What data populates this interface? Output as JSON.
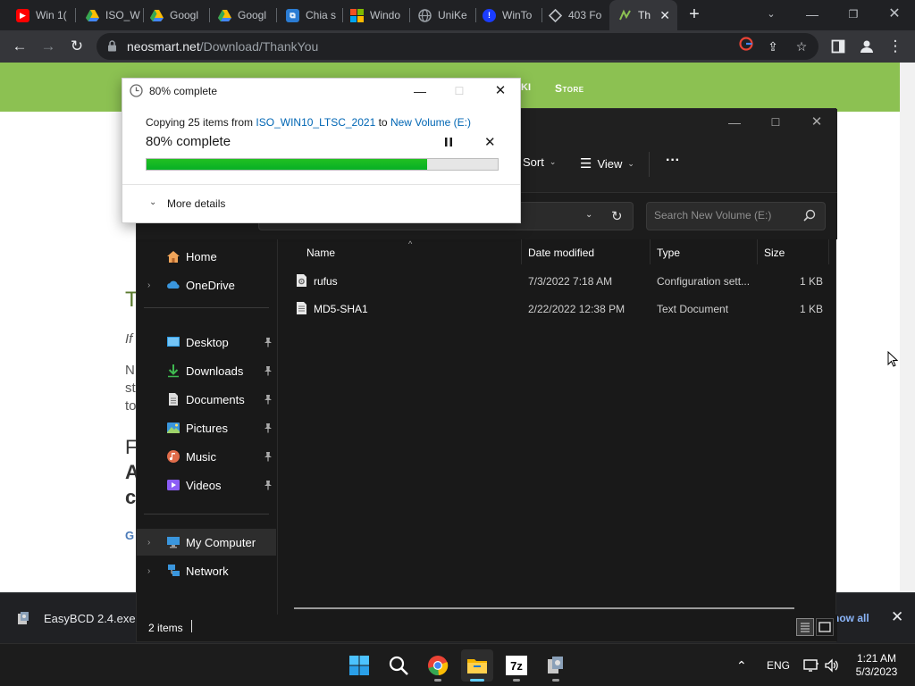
{
  "browser": {
    "tabs": [
      {
        "label": "Win 1(",
        "icon": "youtube-icon",
        "color": "#ff0000"
      },
      {
        "label": "ISO_W",
        "icon": "google-drive-icon",
        "color": "#fbbc04"
      },
      {
        "label": "Googl",
        "icon": "google-drive-icon",
        "color": "#fbbc04"
      },
      {
        "label": "Googl",
        "icon": "google-drive-icon",
        "color": "#fbbc04"
      },
      {
        "label": "Chia s",
        "icon": "shared-folder-icon",
        "color": "#2b7cd3"
      },
      {
        "label": "Windo",
        "icon": "microsoft-icon",
        "color": "#f25022"
      },
      {
        "label": "UniKe",
        "icon": "globe-icon",
        "color": "#9aa0a6"
      },
      {
        "label": "WinTo",
        "icon": "wintohdd-icon",
        "color": "#1a3cff"
      },
      {
        "label": "403 Fo",
        "icon": "diamond-icon",
        "color": "#9aa0a6"
      },
      {
        "label": "Th",
        "icon": "neosmart-icon",
        "color": "#8cc152"
      }
    ],
    "active_tab": 9,
    "url_host": "neosmart.net",
    "url_path": "/Download/ThankYou"
  },
  "website": {
    "nav_store": "Store",
    "nav_fragment": "KI",
    "fragments": [
      "T",
      "If",
      "N",
      "st",
      "to"
    ],
    "big_fragments": [
      "F",
      "A",
      "c"
    ],
    "link_fragment": "G"
  },
  "download_bar": {
    "filename": "EasyBCD 2.4.exe",
    "show_all": "how all"
  },
  "explorer": {
    "commands": {
      "sort": "Sort",
      "view": "View",
      "more": "···"
    },
    "search_placeholder": "Search New Volume (E:)",
    "nav": [
      {
        "label": "Home",
        "icon": "home-icon"
      },
      {
        "label": "OneDrive",
        "icon": "onedrive-icon"
      },
      {
        "label": "Desktop",
        "icon": "desktop-icon"
      },
      {
        "label": "Downloads",
        "icon": "downloads-icon"
      },
      {
        "label": "Documents",
        "icon": "documents-icon"
      },
      {
        "label": "Pictures",
        "icon": "pictures-icon"
      },
      {
        "label": "Music",
        "icon": "music-icon"
      },
      {
        "label": "Videos",
        "icon": "videos-icon"
      },
      {
        "label": "My Computer",
        "icon": "computer-icon"
      },
      {
        "label": "Network",
        "icon": "network-icon"
      }
    ],
    "columns": {
      "name": "Name",
      "date": "Date modified",
      "type": "Type",
      "size": "Size"
    },
    "files": [
      {
        "name": "rufus",
        "date": "7/3/2022 7:18 AM",
        "type": "Configuration sett...",
        "size": "1 KB",
        "icon": "config-file-icon"
      },
      {
        "name": "MD5-SHA1",
        "date": "2/22/2022 12:38 PM",
        "type": "Text Document",
        "size": "1 KB",
        "icon": "text-file-icon"
      }
    ],
    "status": "2 items"
  },
  "copy_dialog": {
    "title": "80% complete",
    "copy_prefix": "Copying 25 items from",
    "source": "ISO_WIN10_LTSC_2021",
    "to_word": "to",
    "destination": "New Volume (E:)",
    "percent_label": "80% complete",
    "progress": 0.8,
    "more_details": "More details"
  },
  "taskbar": {
    "apps": [
      "windows-start-icon",
      "search-icon",
      "chrome-icon",
      "file-explorer-icon",
      "7zip-icon",
      "setup-app-icon"
    ],
    "language": "ENG",
    "time": "1:21 AM",
    "date": "5/3/2023"
  }
}
